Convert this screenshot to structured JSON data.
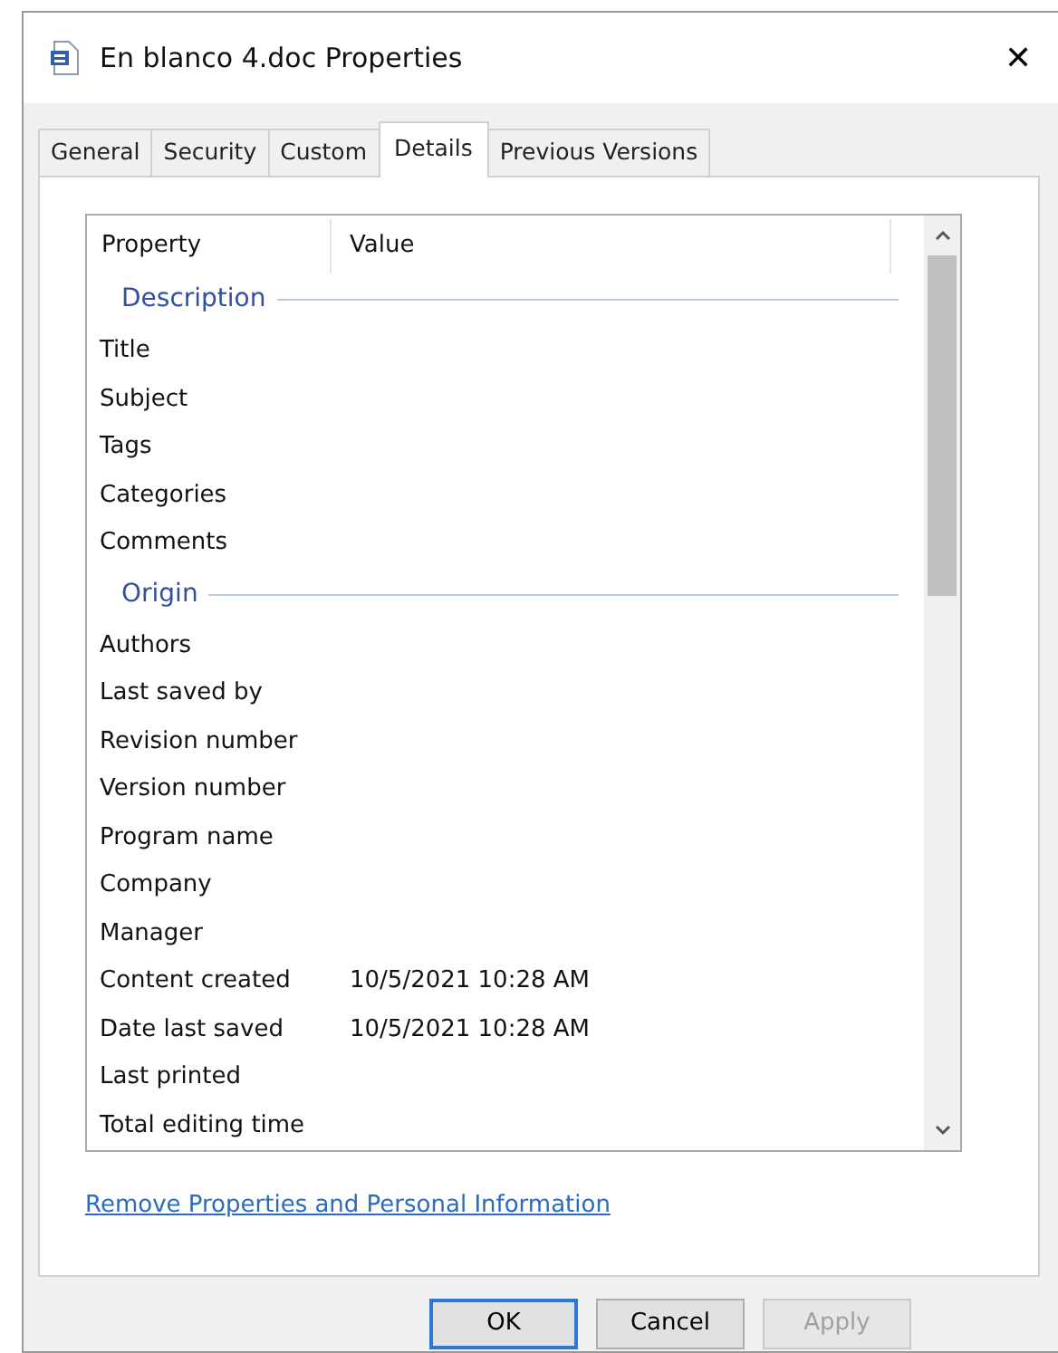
{
  "window": {
    "title": "En blanco 4.doc Properties",
    "close": "✕"
  },
  "tabs": [
    {
      "label": "General",
      "selected": false
    },
    {
      "label": "Security",
      "selected": false
    },
    {
      "label": "Custom",
      "selected": false
    },
    {
      "label": "Details",
      "selected": true
    },
    {
      "label": "Previous Versions",
      "selected": false
    }
  ],
  "table": {
    "columns": [
      "Property",
      "Value"
    ],
    "sections": [
      {
        "title": "Description",
        "rows": [
          {
            "property": "Title"
          },
          {
            "property": "Subject"
          },
          {
            "property": "Tags"
          },
          {
            "property": "Categories"
          },
          {
            "property": "Comments"
          }
        ]
      },
      {
        "title": "Origin",
        "rows": [
          {
            "property": "Authors"
          },
          {
            "property": "Last saved by"
          },
          {
            "property": "Revision number"
          },
          {
            "property": "Version number"
          },
          {
            "property": "Program name"
          },
          {
            "property": "Company"
          },
          {
            "property": "Manager"
          },
          {
            "property": "Content created",
            "value": "10/5/2021 10:28 AM"
          },
          {
            "property": "Date last saved",
            "value": "10/5/2021 10:28 AM"
          },
          {
            "property": "Last printed"
          },
          {
            "property": "Total editing time"
          }
        ]
      }
    ]
  },
  "link": "Remove Properties and Personal Information",
  "buttons": [
    {
      "label": "OK",
      "default": true,
      "disabled": false
    },
    {
      "label": "Cancel",
      "default": false,
      "disabled": false
    },
    {
      "label": "Apply",
      "default": false,
      "disabled": true
    }
  ]
}
